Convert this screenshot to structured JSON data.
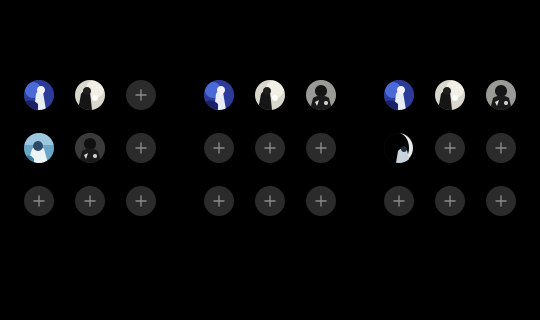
{
  "icons": {
    "add": "plus-icon",
    "avatar": "avatar-photo"
  },
  "colors": {
    "background": "#000000",
    "add_slot": "#2b2b2b",
    "plus": "#8a8a8a"
  },
  "panels": [
    {
      "rows": [
        [
          "photo-blue",
          "photo-moon",
          "add"
        ],
        [
          "photo-sky",
          "photo-dark",
          "add"
        ],
        [
          "add",
          "add",
          "add"
        ]
      ]
    },
    {
      "rows": [
        [
          "photo-blue",
          "photo-moon",
          "photo-dark"
        ],
        [
          "add",
          "add",
          "add"
        ],
        [
          "add",
          "add",
          "add"
        ]
      ]
    },
    {
      "rows": [
        [
          "photo-blue",
          "photo-moon",
          "photo-dark"
        ],
        [
          "photo-crescent",
          "add",
          "add"
        ],
        [
          "add",
          "add",
          "add"
        ]
      ]
    }
  ]
}
